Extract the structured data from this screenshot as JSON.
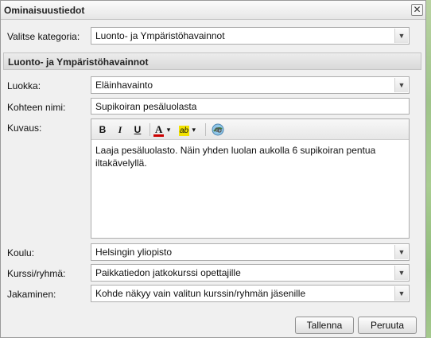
{
  "dialog": {
    "title": "Ominaisuustiedot",
    "close_glyph": "✕"
  },
  "category": {
    "label": "Valitse kategoria:",
    "value": "Luonto- ja Ympäristöhavainnot"
  },
  "section": {
    "heading": "Luonto- ja Ympäristöhavainnot"
  },
  "fields": {
    "luokka": {
      "label": "Luokka:",
      "value": "Eläinhavainto"
    },
    "kohteen_nimi": {
      "label": "Kohteen nimi:",
      "value": "Supikoiran pesäluolasta"
    },
    "kuvaus": {
      "label": "Kuvaus:",
      "text": "Laaja pesäluolasto. Näin yhden luolan aukolla 6 supikoiran pentua iltakävelyllä."
    },
    "koulu": {
      "label": "Koulu:",
      "value": "Helsingin yliopisto"
    },
    "kurssi": {
      "label": "Kurssi/ryhmä:",
      "value": "Paikkatiedon jatkokurssi opettajille"
    },
    "jakaminen": {
      "label": "Jakaminen:",
      "value": "Kohde näkyy vain valitun kurssin/ryhmän jäsenille"
    }
  },
  "toolbar": {
    "bold": "B",
    "italic": "I",
    "underline": "U",
    "font_color": "A",
    "highlight": "ab",
    "colors": {
      "font": "#cc0000",
      "highlight": "#f2e200"
    }
  },
  "buttons": {
    "save": "Tallenna",
    "cancel": "Peruuta"
  },
  "icons": {
    "dropdown_arrow": "▼",
    "small_arrow": "▾"
  }
}
